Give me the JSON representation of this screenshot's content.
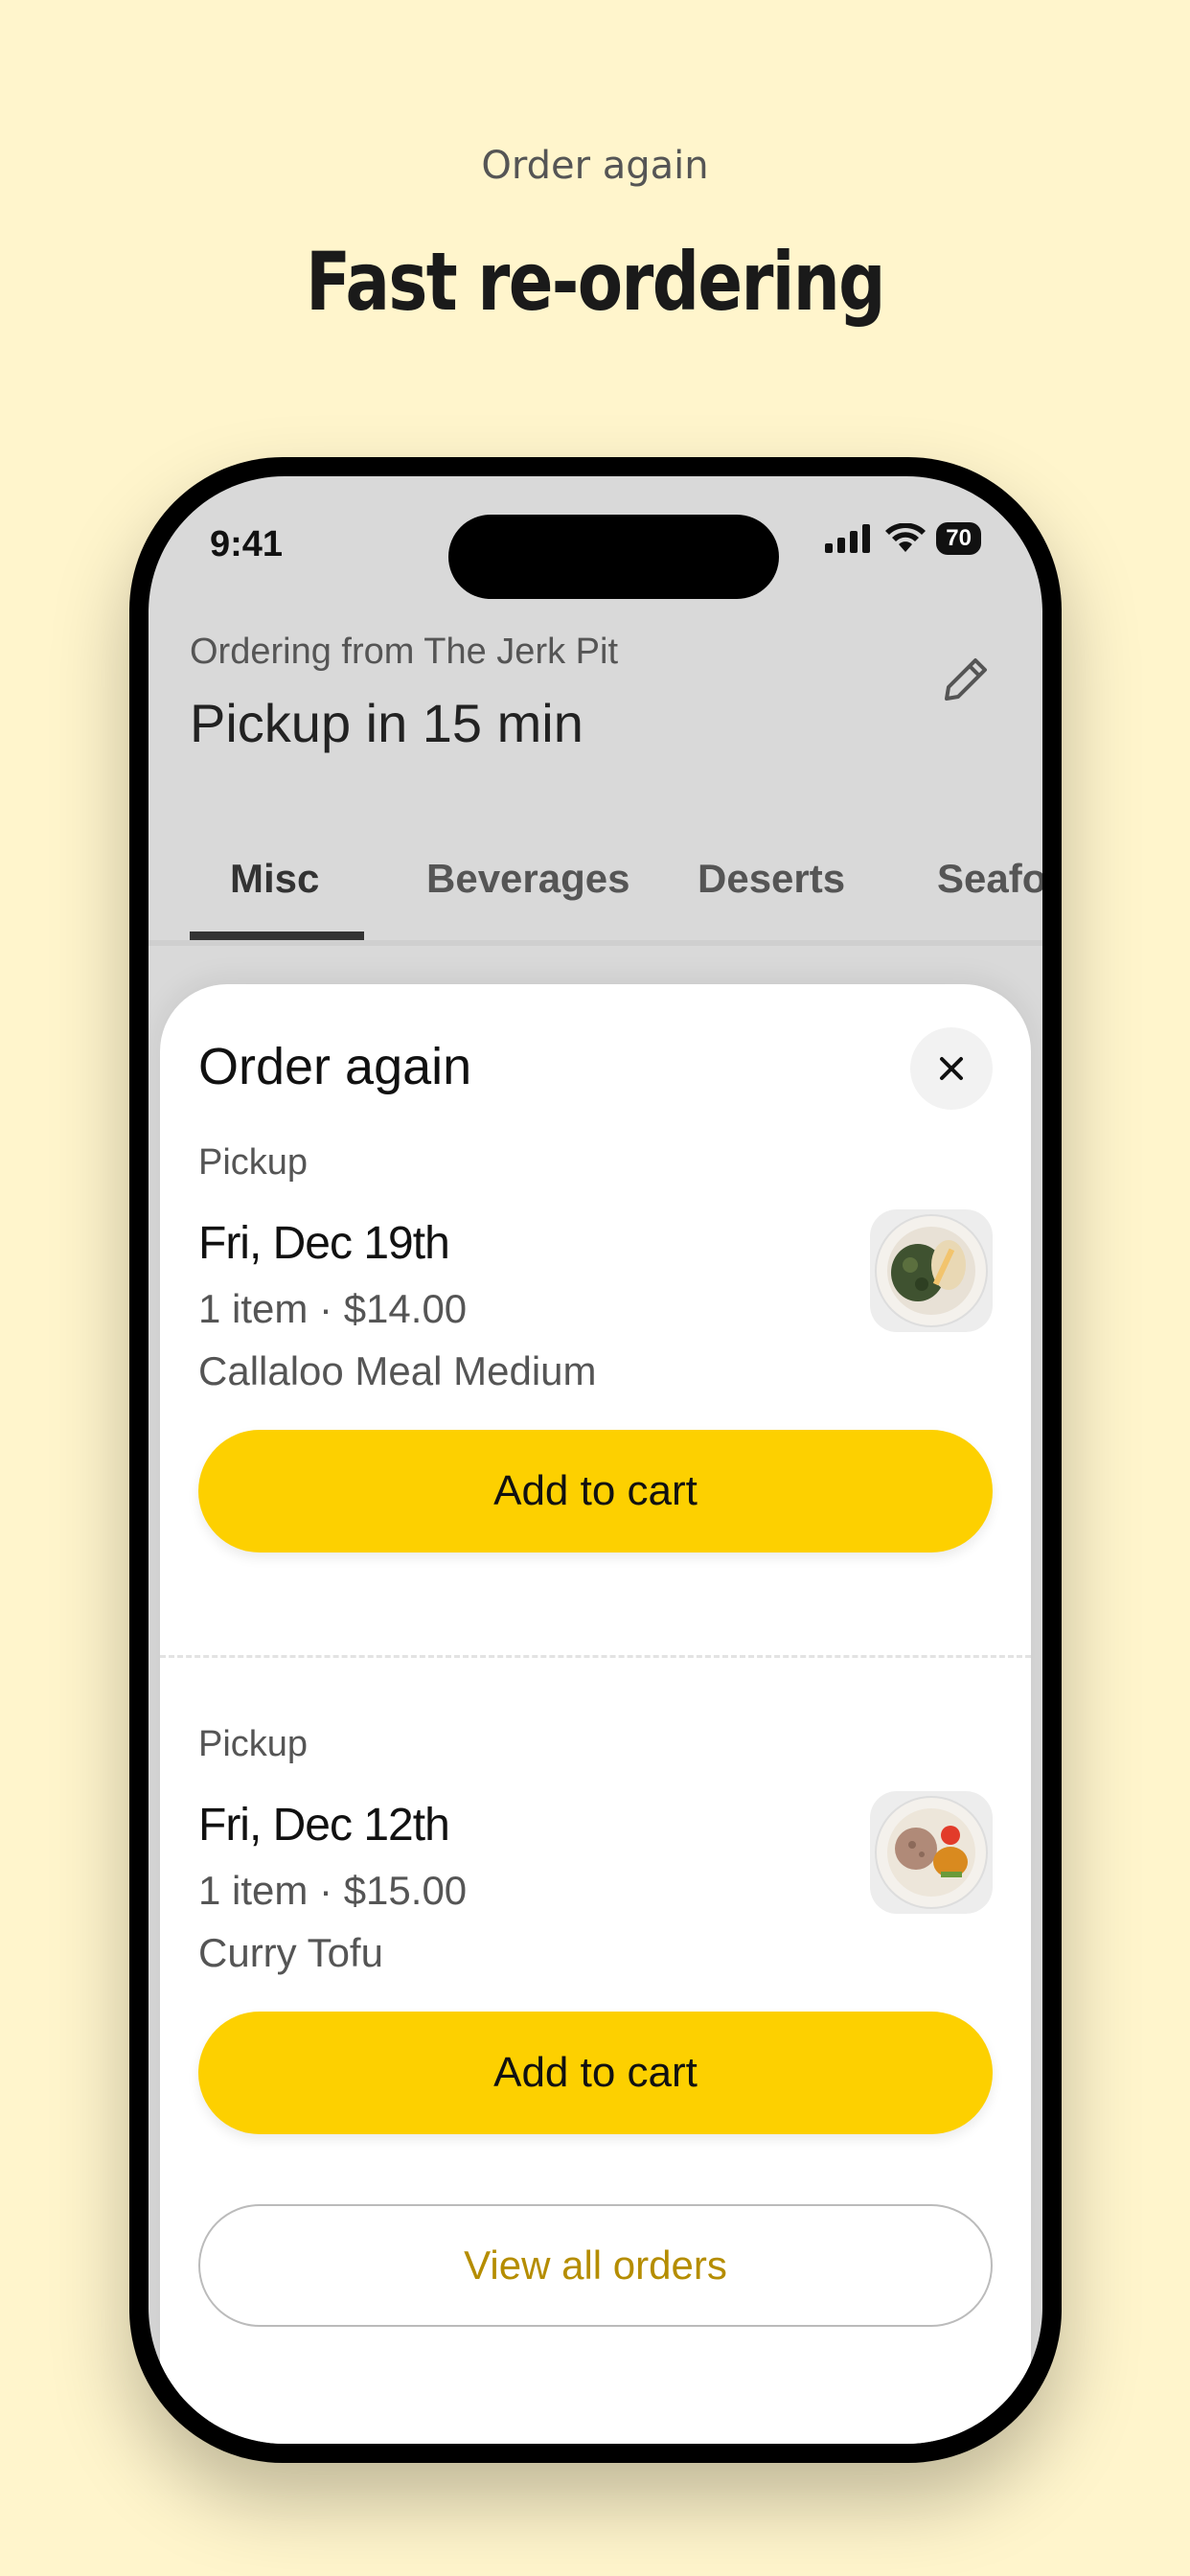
{
  "promo": {
    "subtitle": "Order again",
    "title": "Fast re-ordering"
  },
  "status_bar": {
    "time": "9:41",
    "battery": "70"
  },
  "header": {
    "ordering_from": "Ordering from The Jerk Pit",
    "pickup_time": "Pickup in 15 min"
  },
  "tabs": [
    "Misc",
    "Beverages",
    "Deserts",
    "Seafood"
  ],
  "active_tab": "Misc",
  "sheet": {
    "title": "Order again",
    "orders": [
      {
        "kind": "Pickup",
        "date": "Fri, Dec 19th",
        "summary": "1 item · $14.00",
        "item": "Callaloo Meal Medium",
        "button": "Add to cart"
      },
      {
        "kind": "Pickup",
        "date": "Fri, Dec 12th",
        "summary": "1 item · $15.00",
        "item": "Curry Tofu",
        "button": "Add to cart"
      }
    ],
    "view_all": "View all orders"
  },
  "colors": {
    "background": "#FFF5CC",
    "accent": "#FDD000",
    "link": "#B58D00"
  }
}
